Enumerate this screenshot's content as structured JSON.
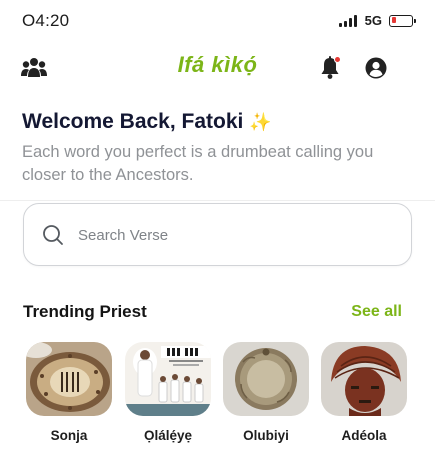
{
  "status_bar": {
    "time": "O4:20",
    "network": "5G",
    "battery_level": 0.25,
    "battery_color": "#e53935"
  },
  "header": {
    "logo": "Ifá kìkọ́",
    "brand_color": "#7cb518",
    "notification_dot_color": "#e53935",
    "icons": [
      "users-icon",
      "bell-icon",
      "profile-icon"
    ]
  },
  "welcome": {
    "title": "Welcome Back, Fatoki",
    "sparkle": "✨",
    "subtitle": "Each word you perfect is a drumbeat calling you closer to the Ancestors."
  },
  "search": {
    "placeholder": "Search Verse",
    "value": ""
  },
  "trending": {
    "title": "Trending Priest",
    "see_all": "See all",
    "priests": [
      {
        "name": "Sonja"
      },
      {
        "name": "Ọlálẹ́yẹ"
      },
      {
        "name": "Olubiyi"
      },
      {
        "name": "Adéola"
      },
      {
        "name": ""
      }
    ]
  },
  "colors": {
    "accent": "#7cb518",
    "title": "#141833",
    "muted": "#8f9296"
  }
}
